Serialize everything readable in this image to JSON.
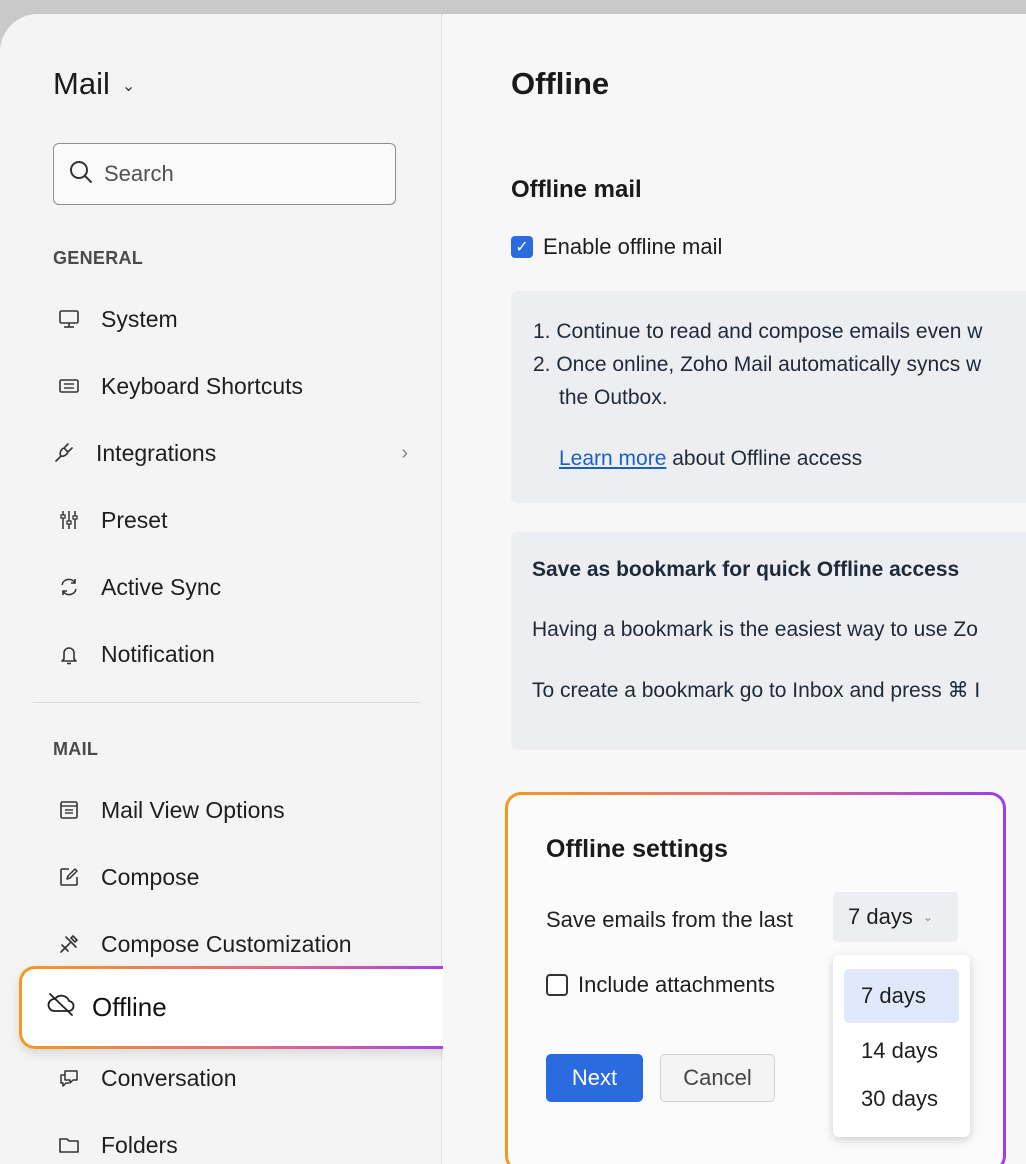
{
  "sidebar": {
    "app_title": "Mail",
    "search_placeholder": "Search",
    "sections": {
      "general": "GENERAL",
      "mail": "MAIL"
    },
    "general_items": [
      {
        "label": "System",
        "icon": "monitor-icon"
      },
      {
        "label": "Keyboard Shortcuts",
        "icon": "keyboard-icon"
      },
      {
        "label": "Integrations",
        "icon": "plug-icon"
      },
      {
        "label": "Preset",
        "icon": "sliders-icon"
      },
      {
        "label": "Active Sync",
        "icon": "sync-icon"
      },
      {
        "label": "Notification",
        "icon": "bell-icon"
      }
    ],
    "mail_items": [
      {
        "label": "Mail View Options",
        "icon": "layout-icon"
      },
      {
        "label": "Compose",
        "icon": "compose-icon"
      },
      {
        "label": "Compose Customization",
        "icon": "tools-icon"
      },
      {
        "label": "Offline",
        "icon": "cloud-off-icon",
        "selected": true
      },
      {
        "label": "Conversation",
        "icon": "chat-icon"
      },
      {
        "label": "Folders",
        "icon": "folder-icon"
      }
    ]
  },
  "main": {
    "page_title": "Offline",
    "section_title": "Offline mail",
    "enable_label": "Enable offline mail",
    "enable_checked": true,
    "info": {
      "line1": "1. Continue to read and compose emails even w",
      "line2": "2. Once online, Zoho Mail automatically syncs w",
      "line3": "the Outbox.",
      "learn_link": "Learn more",
      "learn_rest": " about Offline access"
    },
    "bookmark": {
      "title": "Save as bookmark for quick Offline access",
      "line1": "Having a bookmark is the easiest way to use Zo",
      "line2": "To create a bookmark go to Inbox and press ⌘ I"
    }
  },
  "settings": {
    "title": "Offline settings",
    "save_label": "Save emails from the last",
    "selected_days": "7 days",
    "include_attachments_label": "Include attachments",
    "include_attachments_checked": false,
    "next_label": "Next",
    "cancel_label": "Cancel",
    "options": [
      "7 days",
      "14 days",
      "30 days"
    ]
  },
  "colors": {
    "accent": "#2b6be0",
    "highlight_gradient_start": "#f29a1f",
    "highlight_gradient_end": "#9b3df0"
  }
}
